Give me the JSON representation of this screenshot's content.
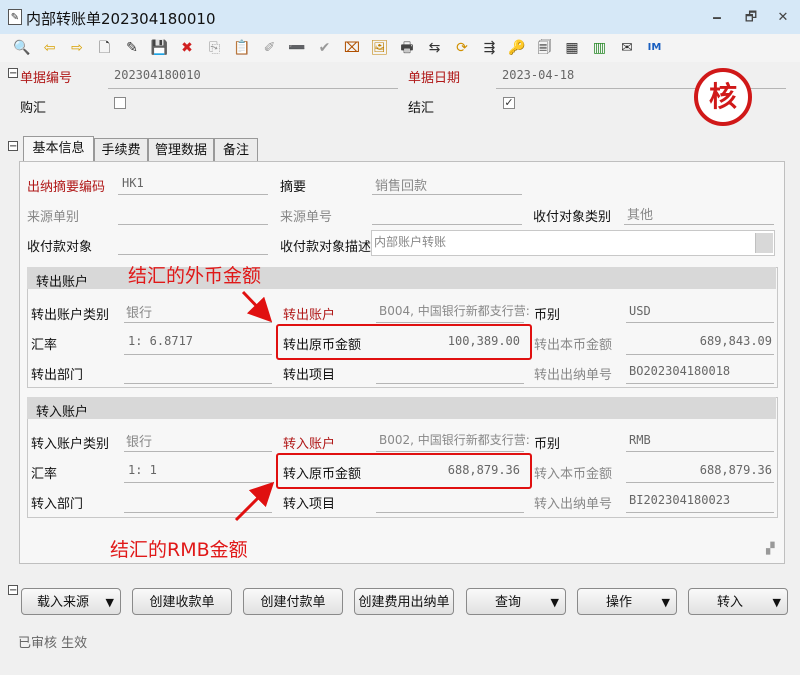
{
  "window": {
    "title": "内部转账单202304180010",
    "controls": [
      "🗕",
      "🗗",
      "✕"
    ]
  },
  "toolbar": {
    "icons": [
      {
        "name": "preview-icon",
        "glyph": "🔍"
      },
      {
        "name": "back-arrow-icon",
        "glyph": "⇦"
      },
      {
        "name": "forward-arrow-icon",
        "glyph": "⇨"
      },
      {
        "name": "new-document-icon",
        "glyph": "🗋"
      },
      {
        "name": "edit-icon",
        "glyph": "✎"
      },
      {
        "name": "save-icon",
        "glyph": "💾"
      },
      {
        "name": "delete-icon",
        "glyph": "✖"
      },
      {
        "name": "copy-icon",
        "glyph": "⎘"
      },
      {
        "name": "paste-icon",
        "glyph": "📋"
      },
      {
        "name": "attachment-icon",
        "glyph": "✐"
      },
      {
        "name": "minus-icon",
        "glyph": "➖"
      },
      {
        "name": "approve-icon",
        "glyph": "✔"
      },
      {
        "name": "lock-icon",
        "glyph": "⌧"
      },
      {
        "name": "picture-icon",
        "glyph": "🖼"
      },
      {
        "name": "print-icon",
        "glyph": "🖶"
      },
      {
        "name": "link-icon",
        "glyph": "⇆"
      },
      {
        "name": "refresh-icon",
        "glyph": "⟳"
      },
      {
        "name": "flow-icon",
        "glyph": "⇶"
      },
      {
        "name": "key-icon",
        "glyph": "🔑"
      },
      {
        "name": "document-icon",
        "glyph": "🗐"
      },
      {
        "name": "calculator-icon",
        "glyph": "▦"
      },
      {
        "name": "green-book-icon",
        "glyph": "▥"
      },
      {
        "name": "mail-icon",
        "glyph": "✉"
      },
      {
        "name": "im-icon",
        "glyph": "IM"
      }
    ]
  },
  "header": {
    "doc_no_label": "单据编号",
    "doc_no": "202304180010",
    "doc_date_label": "单据日期",
    "doc_date": "2023-04-18",
    "forex_purchase_label": "购汇",
    "forex_settle_label": "结汇",
    "forex_settle_checked": "☑",
    "stamp": "核"
  },
  "tabs": [
    "基本信息",
    "手续费",
    "管理数据",
    "备注"
  ],
  "basic": {
    "summary_code_label": "出纳摘要编码",
    "summary_code": "HK1",
    "summary_label": "摘要",
    "summary": "销售回款",
    "source_bill_label": "来源单别",
    "source_no_label": "来源单号",
    "payee_type_label": "收付对象类别",
    "payee_type": "其他",
    "payee_label": "收付款对象",
    "payee_desc_label": "收付款对象描述",
    "payee_desc": "内部账户转账"
  },
  "out_account": {
    "section_title": "转出账户",
    "type_label": "转出账户类别",
    "type": "银行",
    "account_label": "转出账户",
    "account": "B004, 中国银行新都支行营:",
    "currency_label": "币别",
    "currency": "USD",
    "rate_label": "汇率",
    "rate": "1: 6.8717",
    "orig_amount_label": "转出原币金额",
    "orig_amount": "100,389.00",
    "local_amount_label": "转出本币金额",
    "local_amount": "689,843.09",
    "dept_label": "转出部门",
    "project_label": "转出项目",
    "cashier_no_label": "转出出纳单号",
    "cashier_no": "BO202304180018"
  },
  "in_account": {
    "section_title": "转入账户",
    "type_label": "转入账户类别",
    "type": "银行",
    "account_label": "转入账户",
    "account": "B002, 中国银行新都支行营:",
    "currency_label": "币别",
    "currency": "RMB",
    "rate_label": "汇率",
    "rate": "1: 1",
    "orig_amount_label": "转入原币金额",
    "orig_amount": "688,879.36",
    "local_amount_label": "转入本币金额",
    "local_amount": "688,879.36",
    "dept_label": "转入部门",
    "project_label": "转入项目",
    "cashier_no_label": "转入出纳单号",
    "cashier_no": "BI202304180023"
  },
  "annotations": {
    "foreign": "结汇的外币金额",
    "rmb": "结汇的RMB金额"
  },
  "buttons": {
    "load_source": "载入来源",
    "create_receipt": "创建收款单",
    "create_payment": "创建付款单",
    "create_fee": "创建费用出纳单",
    "query": "查询",
    "operation": "操作",
    "transfer_in": "转入"
  },
  "status": "已审核 生效"
}
